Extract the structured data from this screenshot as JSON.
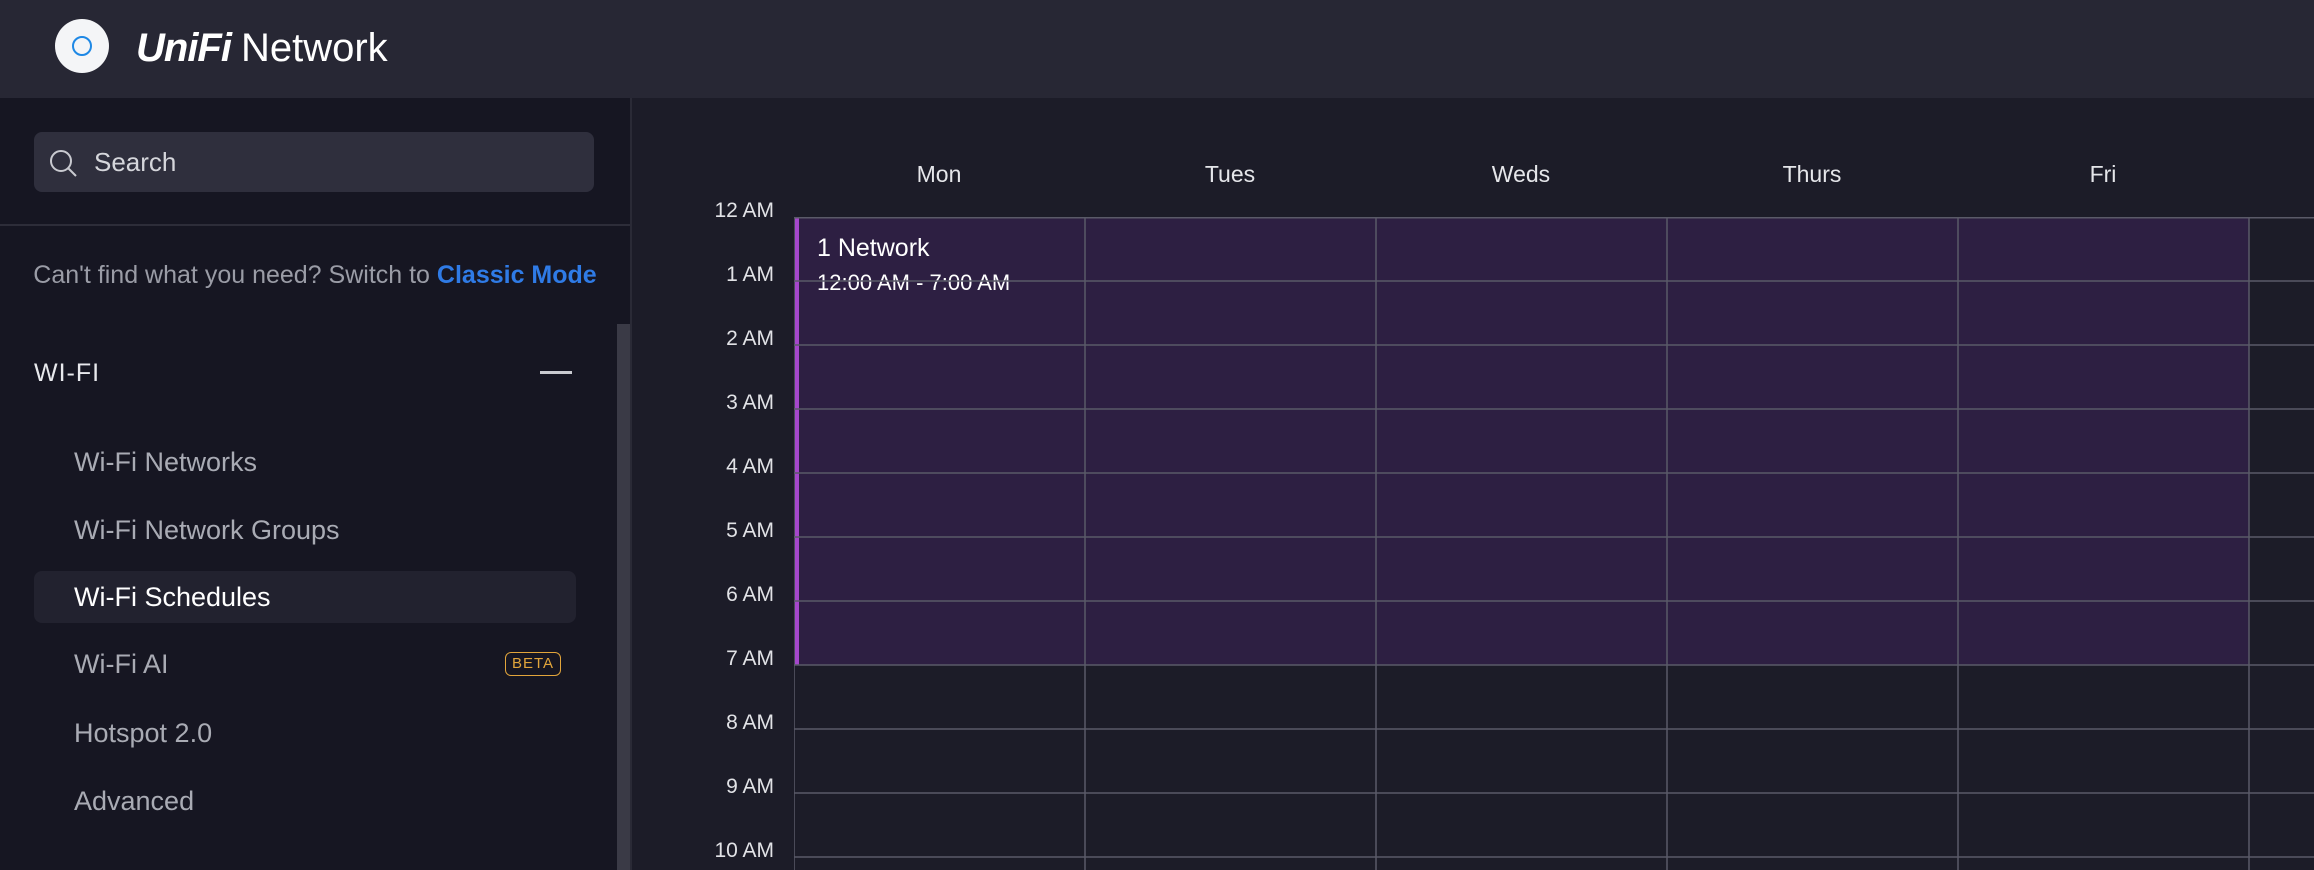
{
  "header": {
    "brand_logo_text": "UniFi",
    "brand_name": "Network"
  },
  "sidebar": {
    "search_placeholder": "Search",
    "classic_prompt": "Can't find what you need? Switch to",
    "classic_link": "Classic Mode",
    "section_title": "WI-FI",
    "items": [
      {
        "label": "Wi-Fi Networks",
        "active": false
      },
      {
        "label": "Wi-Fi Network Groups",
        "active": false
      },
      {
        "label": "Wi-Fi Schedules",
        "active": true
      },
      {
        "label": "Wi-Fi AI",
        "active": false,
        "badge": "BETA"
      },
      {
        "label": "Hotspot 2.0",
        "active": false
      },
      {
        "label": "Advanced",
        "active": false
      }
    ]
  },
  "schedule": {
    "days": [
      "Mon",
      "Tues",
      "Weds",
      "Thurs",
      "Fri"
    ],
    "hours": [
      "12 AM",
      "1 AM",
      "2 AM",
      "3 AM",
      "4 AM",
      "5 AM",
      "6 AM",
      "7 AM",
      "8 AM",
      "9 AM",
      "10 AM"
    ],
    "event": {
      "title": "1 Network",
      "time_range": "12:00 AM - 7:00 AM"
    }
  },
  "colors": {
    "accent_blue": "#2f7be6",
    "event_border": "#a547cc",
    "event_fill": "#2d1f42",
    "beta_badge": "#e2a53b"
  }
}
